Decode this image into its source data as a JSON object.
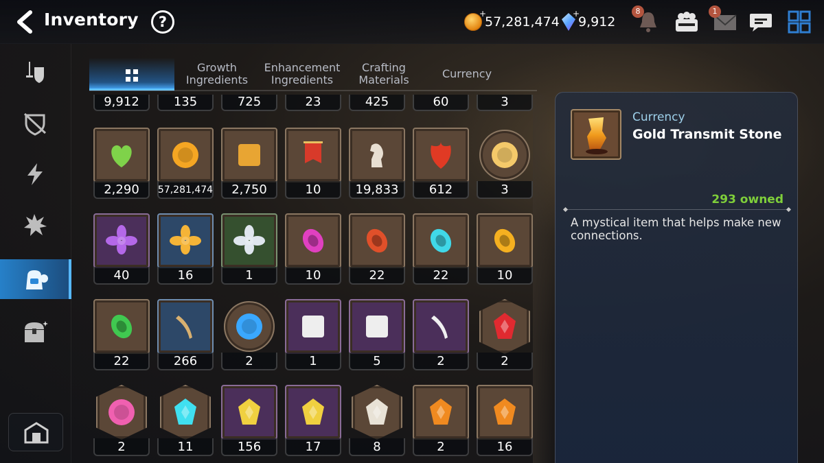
{
  "header": {
    "title": "Inventory",
    "help_label": "?",
    "gold_amount": "57,281,474",
    "crystal_amount": "9,912",
    "bell_badge": "8",
    "mail_badge": "1"
  },
  "sidebar": {
    "items": [
      {
        "name": "equipment",
        "icon": "sword-shield-icon"
      },
      {
        "name": "artifacts",
        "icon": "crossed-shield-icon"
      },
      {
        "name": "exclusive",
        "icon": "lightning-icon"
      },
      {
        "name": "catalysts",
        "icon": "burst-icon"
      },
      {
        "name": "materials",
        "icon": "backpack-icon",
        "active": true
      },
      {
        "name": "chests",
        "icon": "treasure-chest-icon"
      }
    ],
    "bottom_icon": "storage-icon"
  },
  "tabs": [
    {
      "label": "",
      "icon": "grid-icon",
      "active": true
    },
    {
      "label": "Growth Ingredients"
    },
    {
      "label": "Enhancement Ingredients"
    },
    {
      "label": "Crafting Materials"
    },
    {
      "label": "Currency"
    }
  ],
  "grid": {
    "partial_row": [
      "9,912",
      "135",
      "725",
      "23",
      "425",
      "60",
      "3"
    ],
    "rows": [
      [
        {
          "count": "2,290",
          "icon": "green-heart-icon",
          "frame": "brown"
        },
        {
          "count": "57,281,474",
          "icon": "gold-coin-icon",
          "frame": "brown",
          "small": true
        },
        {
          "count": "2,750",
          "icon": "fist-emblem-icon",
          "frame": "brown"
        },
        {
          "count": "10",
          "icon": "war-banner-icon",
          "frame": "brown"
        },
        {
          "count": "19,833",
          "icon": "knight-chess-icon",
          "frame": "brown"
        },
        {
          "count": "612",
          "icon": "red-leaf-icon",
          "frame": "brown"
        },
        {
          "count": "3",
          "icon": "pet-face-icon",
          "frame": "round"
        }
      ],
      [
        {
          "count": "40",
          "icon": "purple-flower-icon",
          "frame": "purple"
        },
        {
          "count": "16",
          "icon": "gold-flower-icon",
          "frame": "blue"
        },
        {
          "count": "1",
          "icon": "silver-flower-icon",
          "frame": "green"
        },
        {
          "count": "10",
          "icon": "pink-stone-icon",
          "frame": "brown"
        },
        {
          "count": "22",
          "icon": "red-stone-icon",
          "frame": "brown"
        },
        {
          "count": "22",
          "icon": "cyan-stone-icon",
          "frame": "brown"
        },
        {
          "count": "10",
          "icon": "yellow-stone-icon",
          "frame": "brown"
        }
      ],
      [
        {
          "count": "22",
          "icon": "green-stone-icon",
          "frame": "brown"
        },
        {
          "count": "266",
          "icon": "ginseng-root-icon",
          "frame": "blue"
        },
        {
          "count": "2",
          "icon": "blue-rune-circle-icon",
          "frame": "round"
        },
        {
          "count": "1",
          "icon": "pet-pack-icon",
          "frame": "purple"
        },
        {
          "count": "5",
          "icon": "pet-pack-icon",
          "frame": "purple"
        },
        {
          "count": "2",
          "icon": "feather-duster-icon",
          "frame": "purple"
        },
        {
          "count": "2",
          "icon": "red-gem-icon",
          "frame": "hex"
        }
      ],
      [
        {
          "count": "2",
          "icon": "pink-potion-icon",
          "frame": "hex"
        },
        {
          "count": "11",
          "icon": "dark-crystal-icon",
          "frame": "hex"
        },
        {
          "count": "156",
          "icon": "gold-rune-stone-icon",
          "frame": "purple"
        },
        {
          "count": "17",
          "icon": "gold-rune-stone-icon",
          "frame": "purple"
        },
        {
          "count": "8",
          "icon": "white-crystal-icon",
          "frame": "hex"
        },
        {
          "count": "2",
          "icon": "orange-rune-stone-icon",
          "frame": "brown"
        },
        {
          "count": "16",
          "icon": "orange-rune-stone-icon",
          "frame": "brown"
        }
      ]
    ]
  },
  "detail": {
    "category": "Currency",
    "name": "Gold Transmit Stone",
    "owned": "293 owned",
    "description": "A mystical item that helps make new connections.",
    "icon": "gold-transmit-stone-icon"
  },
  "colors": {
    "accent_blue": "#2f8fe0",
    "owned_green": "#7fcf3a",
    "frame_brown": "#5b4737"
  }
}
